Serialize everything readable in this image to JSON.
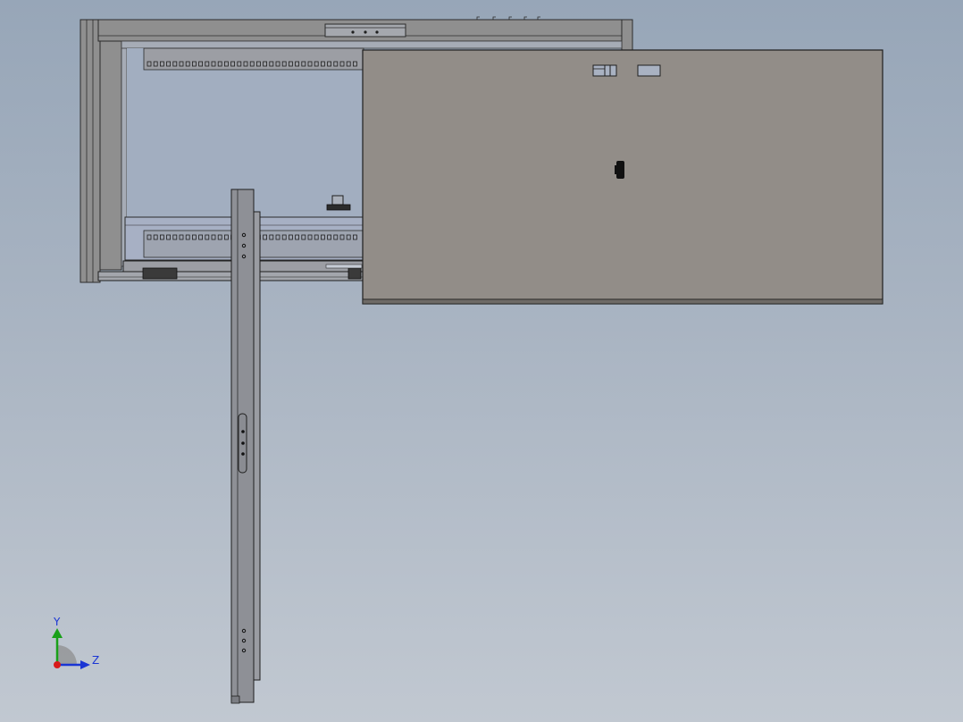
{
  "viewport": {
    "background_top": "#97a6b8",
    "background_bottom": "#c1c8d1"
  },
  "model": {
    "frame_color": "#8f8f8f",
    "frame_edge": "#2b2b2b",
    "panel_color": "#928d88",
    "panel_edge": "#1e1e1e",
    "rail_color": "#9c9ea4",
    "interior_color": "#a2aec0"
  },
  "triad": {
    "y_label": "Y",
    "z_label": "Z",
    "y_color": "#19a019",
    "z_color": "#1a35d4",
    "x_color": "#d81a1a"
  }
}
